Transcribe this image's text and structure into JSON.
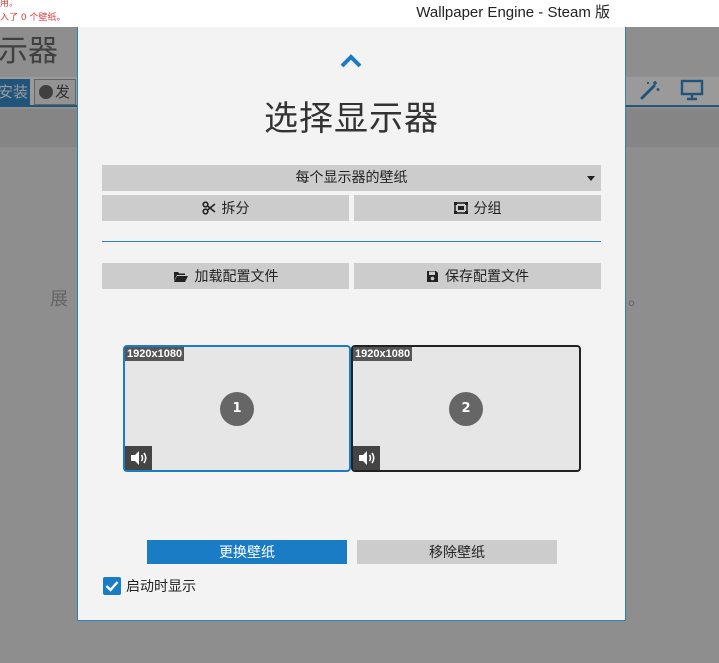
{
  "window": {
    "title": "Wallpaper Engine - Steam 版"
  },
  "background": {
    "notice_line1": "用。",
    "notice_line2": "入了 0 个壁纸。",
    "heading": "示器 ",
    "install_label": "安装",
    "publish_label": "发",
    "empty_text_left": "展",
    "empty_text_right": "。"
  },
  "modal": {
    "title": "选择显示器",
    "mode_select": {
      "value": "每个显示器的壁纸"
    },
    "split_label": "拆分",
    "group_label": "分组",
    "load_profile_label": "加载配置文件",
    "save_profile_label": "保存配置文件",
    "monitors": [
      {
        "number": "1",
        "resolution": "1920x1080",
        "selected": true
      },
      {
        "number": "2",
        "resolution": "1920x1080",
        "selected": false
      }
    ],
    "change_wallpaper_label": "更换壁纸",
    "remove_wallpaper_label": "移除壁纸",
    "show_on_startup": {
      "label": "启动时显示",
      "checked": true
    }
  },
  "colors": {
    "accent": "#1a7cc4",
    "button_gray": "#cccccc",
    "modal_bg": "#f3f3f3"
  }
}
